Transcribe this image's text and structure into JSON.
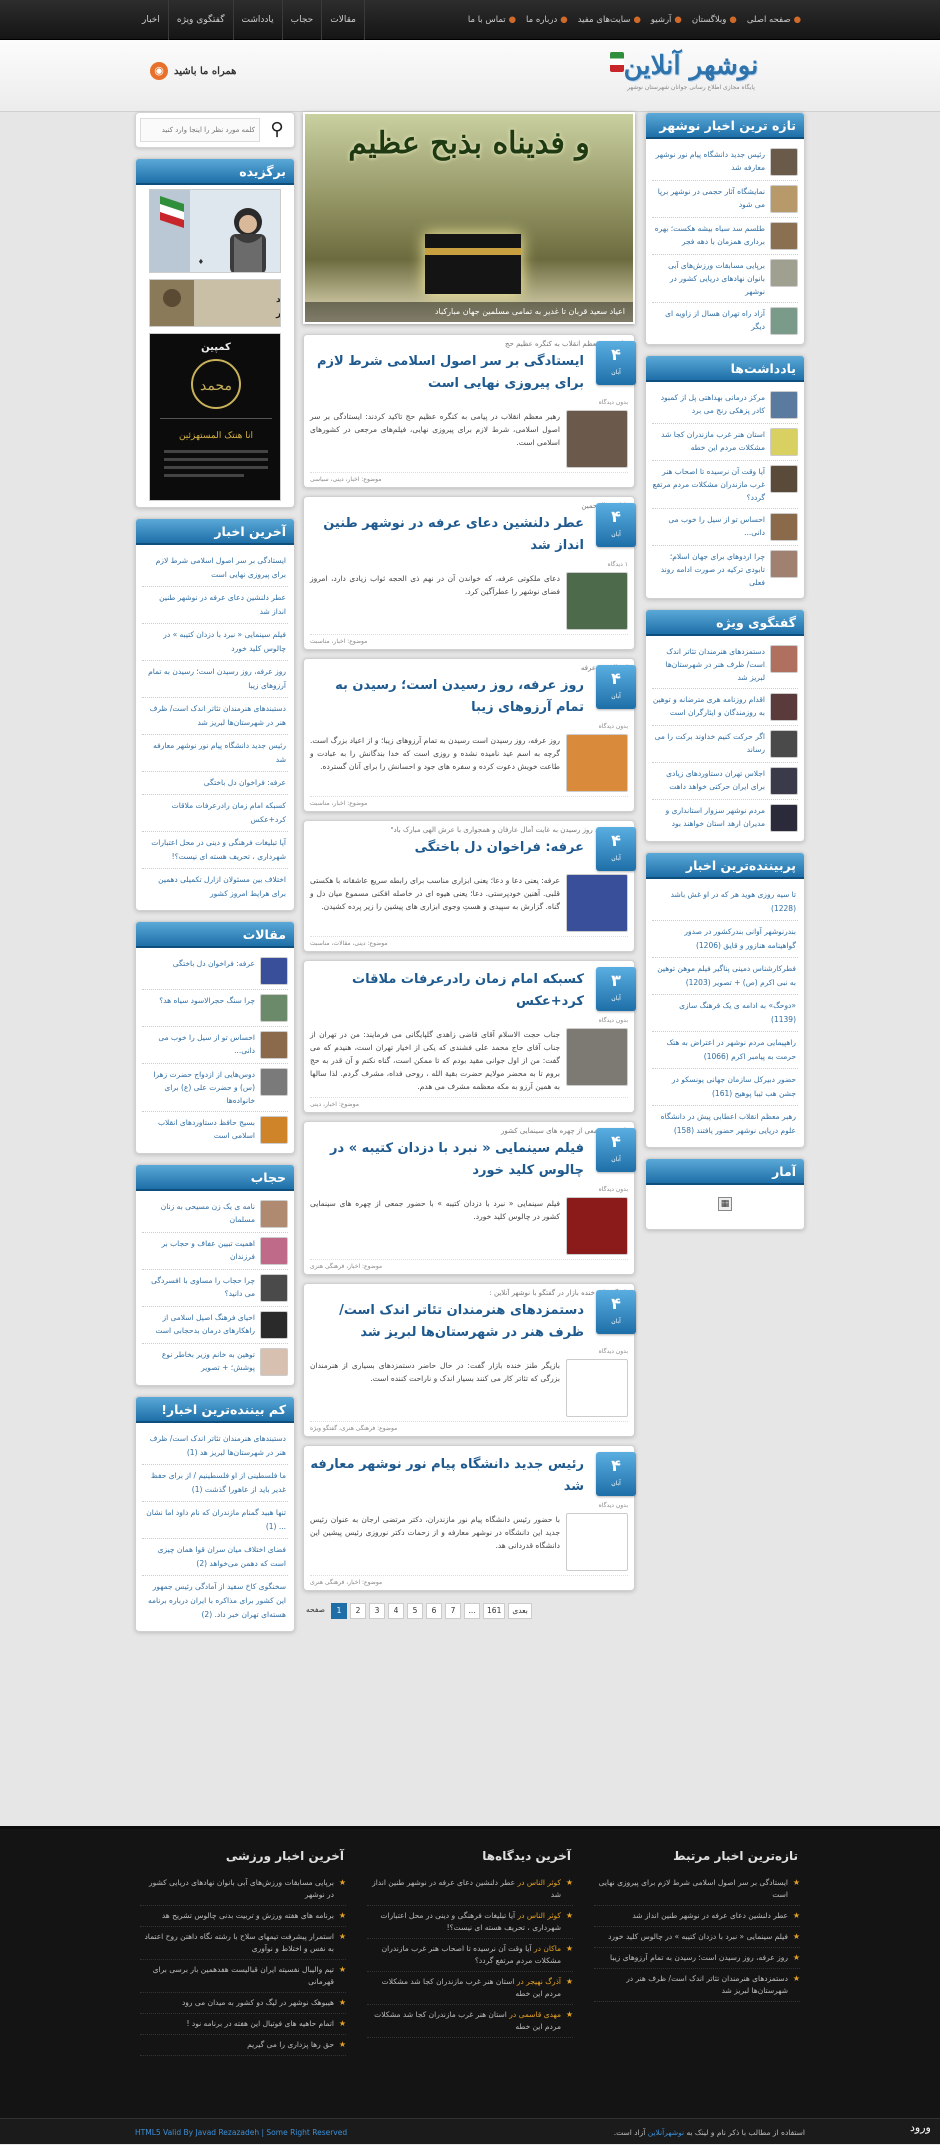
{
  "topbar": {
    "main_menu": [
      "صفحه اصلی",
      "وبلاگستان",
      "آرشیو",
      "سایت‌های مفید",
      "درباره ما",
      "تماس با ما"
    ],
    "side_menu": [
      "مقالات",
      "حجاب",
      "یادداشت",
      "گفتگوی ویژه",
      "اخبار"
    ]
  },
  "header": {
    "logo_text": "نوشهر آنلاین",
    "logo_sub": "پایگاه مجازی اطلاع رسانی جوانان شهرستان نوشهر",
    "follow_label": "همراه ما باشید"
  },
  "search": {
    "placeholder": "کلمه مورد نظر را اینجا وارد کنید"
  },
  "slider": {
    "calligraphy": "و فدیناه بذبح عظیم",
    "caption": "اعیاد سعید قربان تا غدیر به تمامی مسلمین جهان مبارکباد"
  },
  "left": {
    "featured": {
      "title": "برگزیده",
      "banners": [
        "سرداران شهید شهرستان نوشهر",
        "کمپین - انا هنتک المستهزئین"
      ]
    },
    "latest_news": {
      "title": "آخرین اخبار",
      "items": [
        "ایستادگی بر سر اصول اسلامی شرط لازم برای پیروزی نهایی است",
        "عطر دلنشین دعای عرفه در نوشهر طنین انداز شد",
        "فیلم سینمایی « نبرد با دزدان کتیبه » در چالوس کلید خورد",
        "روز عرفه، روز رسیدن است؛ رسیدن به تمام آرزوهای زیبا",
        "دستبندهای هنرمندان تئاتر اندک است/ ظرف هنر در شهرستان‌ها لبریز شد",
        "رئیس جدید دانشگاه پیام نور نوشهر معارفه شد",
        "عرفه: فراخوان دل باختگی",
        "کسبکه امام زمان رادرعرفات ملاقات کرد+عکس",
        "آیا تبلیغات فرهنگی و دینی در محل اعتبارات شهرداری ، تحریف هسته ای نیست؟!",
        "اختلاف بین مسئولان ازارل تکمیلی دهمین برای هرایط امروز کشور"
      ]
    },
    "articles": {
      "title": "مقالات",
      "items": [
        "عرفه: فراخوان دل باختگی",
        "چرا سنگ حجرالاسود سیاه هد؟",
        "احساس تو از سیل را خوب می دانی...",
        "دوس‌هایی از ازدواج حضرت زهرا (س) و حضرت علی (ع) برای خانواده‌ها",
        "بسیج حافظ دستاوردهای انقلاب اسلامی است"
      ]
    },
    "hijab": {
      "title": "حجاب",
      "items": [
        "نامه ی یک زن مسیحی به زنان مسلمان",
        "اهمیت تبیین عفاف و حجاب بر فرزندان",
        "چرا حجاب را مساوی با افسردگی می دانید؟",
        "احیای فرهنگ اصیل اسلامی از راهکارهای درمان بدحجابی است",
        "توهین به خانم وزیر بخاطر نوع پوشش؛ + تصویر"
      ]
    },
    "least_read": {
      "title": "کم بیننده‌ترین اخبار!",
      "items": [
        "دستبندهای هنرمندان تئاتر اندک است/ ظرف هنر در شهرستان‌ها لبریز هد (1)",
        "ما فلسطینی از او فلسطینیم / از برای حفظ غدیر باید از عاهورا گذشت (1)",
        "تنها هبید گمنام مازندران که نام داود اما نشان ... (1)",
        "فضای اختلاف میان سران قوا همان چیزی است که دهمن می‌خواهد (2)",
        "سخنگوی کاخ سفید از آمادگی رئیس جمهور این کشور برای مذاکره با ایران درباره برنامه هسته‌ای تهران خبر داد. (2)"
      ]
    }
  },
  "posts": [
    {
      "day": "۴",
      "month": "آبان",
      "kicker": "پیام رهبر معظم انقلاب به کنگره عظیم حج",
      "title": "ایستادگی بر سر اصول اسلامی شرط لازم برای پیروزی نهایی است",
      "comments": "بدون دیدگاه",
      "excerpt": "رهبر معظم انقلاب در پیامی به کنگره عظیم حج تاکید کردند: ایستادگی بر سر اصول اسلامی، شرط لازم برای پیروزی نهایی، فیلم‌های مرجعی در کشورهای اسلامی است.",
      "category": "موضوع: اخبار، دینی، سیاسی",
      "thumb_color": "#6b5a4b"
    },
    {
      "day": "۴",
      "month": "آبان",
      "kicker": "با ازجم الرحمین",
      "title": "عطر دلنشین دعای عرفه در نوشهر طنین انداز شد",
      "comments": "۱ دیدگاه",
      "excerpt": "دعای ملکوتی عرفه، که خواندن آن در نهم ذی الحجه ثواب زیادی دارد، امروز فضای نوشهر را عطرآگین کرد.",
      "category": "موضوع: اخبار، مناسبت",
      "thumb_color": "#4d6a4a"
    },
    {
      "day": "۴",
      "month": "آبان",
      "kicker": "اعمال روز عرفه",
      "title": "روز عرفه، روز رسیدن است؛ رسیدن به تمام آرزوهای زیبا",
      "comments": "بدون دیدگاه",
      "excerpt": "روز عرفه، روز رسیدن است رسیدن به تمام آرزوهای زیبا؛ و از اعیاد بزرگ است. گرچه به اسم عید نامیده نشده و روزی است که خدا بندگانش را به عبادت و طاعت خویش دعوت کرده و سفره های جود و احسانش را برای آنان گسترده.",
      "category": "موضوع: اخبار، مناسبت",
      "thumb_color": "#d98a3a"
    },
    {
      "day": "۴",
      "month": "آبان",
      "kicker": "\"روز عرفه، روز رسیدن به غایت آمال عارفان و همجواری با عرش الهی مبارک باد\"",
      "title": "عرفه: فراخوان دل باختگی",
      "comments": "بدون دیدگاه",
      "excerpt": "عرفه: یعنی دعا و دعا؛ یعنی ابزاری مناسب برای رابطه سریع عاشقانه با هکستی قلبی. آهنین خودپرستی. دعا؛ یعنی هیوه ای در خاصله افکنی مسموع میان دل و گناه. گزارش به سپیدی و هستِ وجوی ابزاری های پیشین را زیر پرده کشیدن.",
      "category": "موضوع: دینی، مقالات، مناسبت",
      "thumb_color": "#3a4f9a"
    },
    {
      "day": "۳",
      "month": "آبان",
      "kicker": "",
      "title": "کسبکه امام زمان رادرعرفات ملاقات کرد+عکس",
      "comments": "بدون دیدگاه",
      "excerpt": "جناب حجت الاسلام آقای قاضی زاهدی گلپایگانی می فرمایند: من در تهران از جناب آقای حاج محمد علی فشندی که یکی از اخیار تهران است، هنیدم که می گفت: من از اول جوانی مقید بودم که تا ممکن است، گناه نکنم و آن قدر به حج بروم تا به محضر مولایم حضرت بقیة الله ، روحی فداه، مشرف گردم. لذا سالها به همین آرزو به مکه معظمه مشرف می هدم.",
      "category": "موضوع: اخبار، دینی",
      "thumb_color": "#7d7a74"
    },
    {
      "day": "۴",
      "month": "آبان",
      "kicker": "با حضور جمعی از چهره های سینمایی کشور",
      "title": "فیلم سینمایی « نبرد با دزدان کتیبه » در چالوس کلید خورد",
      "comments": "بدون دیدگاه",
      "excerpt": "فیلم سینمایی « نبرد با دزدان کتیبه » با حضور جمعی از چهره های سینمایی کشور در چالوس کلید خورد.",
      "category": "موضوع: اخبار، فرهنگی هنری",
      "thumb_color": "#8b1a1a"
    },
    {
      "day": "۴",
      "month": "آبان",
      "kicker": "بازیگر طنز خنده بازار در گفتگو با نوشهر آنلاین :",
      "title": "دستمزدهای هنرمندان تئاتر اندک است/ ظرف هنر در شهرستان‌ها لبریز شد",
      "comments": "بدون دیدگاه",
      "excerpt": "بازیگر طنز خنده بازار گفت: در حال حاضر دستمزدهای بسیاری از هنرمندان بزرگی که تئاتر کار می کنند بسیار اندک و ناراحت کننده است.",
      "category": "موضوع: فرهنگی هنری، گفتگو ویژه",
      "thumb_color": "#ffffff"
    },
    {
      "day": "۴",
      "month": "آبان",
      "kicker": "",
      "title": "رئیس جدید دانشگاه پیام نور نوشهر معارفه شد",
      "comments": "بدون دیدگاه",
      "excerpt": "با حضور رئیس دانشگاه پیام نور مازندران، دکتر مرتضی ارجان به عنوان رئیس جدید این دانشگاه در نوشهر معارفه و از زحمات دکتر نوروزی رئیس پیشین این دانشگاه قدردانی هد.",
      "category": "موضوع: اخبار، فرهنگی هنری",
      "thumb_color": "#ffffff"
    }
  ],
  "pager": {
    "label": "صفحه",
    "pages": [
      "1",
      "2",
      "3",
      "4",
      "5",
      "6",
      "7",
      "...",
      "161"
    ],
    "next": "بعدی"
  },
  "right": {
    "latest": {
      "title": "تازه ترین اخبار نوشهر",
      "items": [
        "رئیس جدید دانشگاه پیام نور نوشهر معارفه شد",
        "نمایشگاه آثار حجمی در نوشهر برپا می شود",
        "طلسم سد سیاه بیشه هکست؛ بهره برداری همزمان با دهه فجر",
        "برپایی مسابقات ورزش‌های آبی بانوان نهادهای دریایی کشور در نوشهر",
        "آزاد راه تهران هسال از زاویه ای دیگر"
      ]
    },
    "notes": {
      "title": "یادداشت‌ها",
      "items": [
        "مرکز درمانی بهداهتی پل از کمبود کادر پزهکی رنج می برد",
        "استان هنر غرب مازندران کجا شد مشکلات مردم این خطه",
        "آیا وقت آن نرسیده تا اصحاب هنر غرب مازندران مشکلات مردم مرتفع گردد؟",
        "احساس تو از سیل را خوب می دانی...",
        "چرا اردوهای برای جهان اسلام؛ تابودی ترکیه در صورت ادامه روند فعلی"
      ]
    },
    "interviews": {
      "title": "گفتگوی ویژه",
      "items": [
        "دستمزدهای هنرمندان تئاتر اندک است/ ظرف هنر در شهرستان‌ها لبریز شد",
        "اقدام روزنامه هری مترضانه و توهین به روزمندگان و ایثارگران است",
        "اگر حرکت کنیم خداوند برکت را می رساند",
        "اجلاس تهران دستاوردهای زیادی برای ایران حرکتی خواهد داهت",
        "مردم نوشهر سزوار استانداری و مدیران ارهد استان خواهند بود"
      ]
    },
    "most_read": {
      "title": "پربیننده‌ترین اخبار",
      "items": [
        "تا سیه روزی هوید هر که در او غش باشد (1228)",
        "بندرنوشهر آوانی بندرکشور در صدور گواهینامه هنازور و قایق (1206)",
        "فطرکارشناس دمینی پناگیر فیلم موهن توهین به نبی اکرم (ص) + تصویر (1203)",
        "«دوحگ» به ادامه ی یک فرهنگ سازی (1139)",
        "راهپیمایی مردم نوشهر در اعتراض به هتک حرمت به پیامبر اکرم (1066)",
        "حضور دبیرکل سازمان جهانی یونسکو در جشن هب ثیبا پوهیح (161)",
        "رهبر معظم انقلاب اعطابی پیش در دانشگاه علوم دریایی نوشهر حضور یافتند (158)"
      ]
    },
    "stats": {
      "title": "آمار"
    }
  },
  "footer": {
    "col1": {
      "title": "تازه‌ترین اخبار مرتبط",
      "items": [
        "ایستادگی بر سر اصول اسلامی شرط لازم برای پیروزی نهایی است",
        "عطر دلنشین دعای عرفه در نوشهر طنین انداز شد",
        "فیلم سینمایی « نبرد با دزدان کتیبه » در چالوس کلید خورد",
        "روز عرفه، روز رسیدن است؛ رسیدن به تمام آرزوهای زیبا",
        "دستمزدهای هنرمندان تئاتر اندک است/ ظرف هنر در شهرستان‌ها لبریز شد"
      ]
    },
    "col2": {
      "title": "آخرین دیدگاه‌ها",
      "items": [
        {
          "by": "کوثر الناس در",
          "text": "عطر دلنشین دعای عرفه در نوشهر طنین انداز شد"
        },
        {
          "by": "کوثر الناس در",
          "text": "آیا تبلیغات فرهنگی و دینی در محل اعتبارات شهرداری ، تحریف هسته ای نیست؟!"
        },
        {
          "by": "ماکان در",
          "text": "آیا وقت آن نرسیده تا اصحاب هنر غرب مازندران مشکلات مردم مرتفع گردد؟"
        },
        {
          "by": "آذرگ نهیجر در",
          "text": "استان هنر غرب مازندران کجا شد مشکلات مردم این خطه"
        },
        {
          "by": "مهدی قاسمی در",
          "text": "استان هنر غرب مازندران کجا شد مشکلات مردم این خطه"
        }
      ]
    },
    "col3": {
      "title": "آخرین اخبار ورزشی",
      "items": [
        "برپایی مسابقات ورزش‌های آبی بانوان نهادهای دریایی کشور در نوشهر",
        "برنامه های هفته ورزش و تربیت بدنی چالوس تشریح هد",
        "استمرار پیشرفت تیمهای سلاح با رشته نگاه داهتن روح اعتماد به نفس و اختلاط و نوآوری",
        "تیم والیبال نفسیته ایران قبالیست هفدهمین بار برسی برای قهرمانی",
        "هیبوهک نوشهر در لیگ دو کشور به میدان می رود",
        "اتمام حاهیه های فوتبال این هفته در برنامه نود !",
        "حق رها پزداری را می گیریم"
      ]
    }
  },
  "bottom": {
    "copyright_pre": "استفاده از مطالب با ذکر نام و لینک به",
    "copyright_site": "نوشهرآنلاین",
    "copyright_post": "آزاد است.",
    "credit": "HTML5 Valid By Javad Rezazadeh | Some Right Reserved",
    "badge": "ورود"
  }
}
